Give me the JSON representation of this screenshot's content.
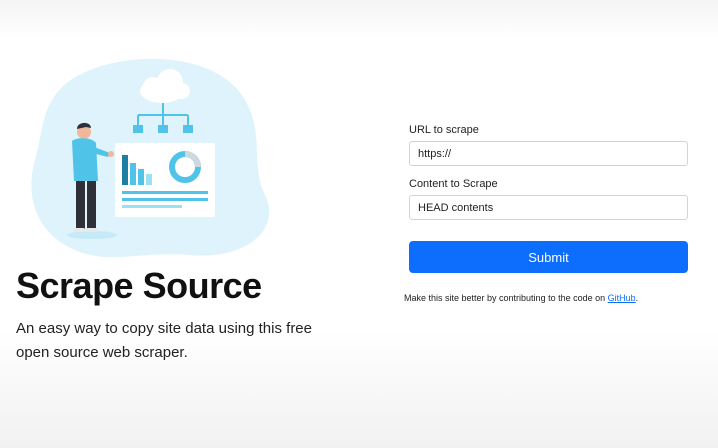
{
  "hero": {
    "title": "Scrape Source",
    "subtitle": "An easy way to copy site data using this free open source web scraper."
  },
  "form": {
    "url_label": "URL to scrape",
    "url_value": "https://",
    "content_label": "Content to Scrape",
    "content_value": "HEAD contents",
    "submit_label": "Submit"
  },
  "footer": {
    "text_before": "Make this site better by contributing to the code on ",
    "link_text": "GitHub",
    "text_after": "."
  },
  "colors": {
    "accent": "#0d6efd",
    "illustration_teal": "#4fc3e8",
    "illustration_bg": "#def3fb"
  },
  "icons": [
    "cloud-icon",
    "person-illustration",
    "dashboard-illustration"
  ]
}
